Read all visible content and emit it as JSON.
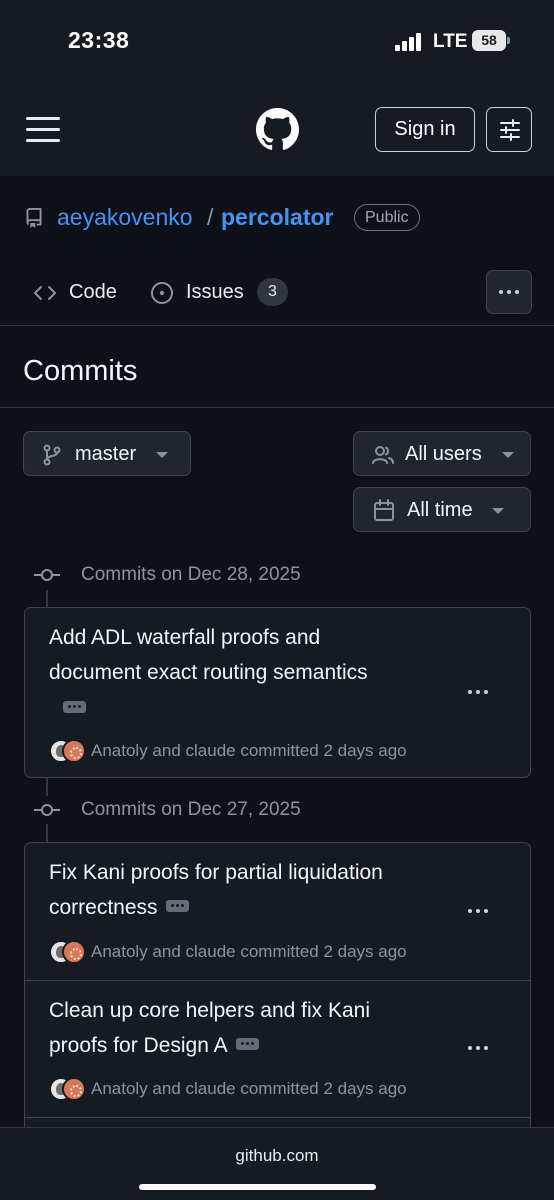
{
  "status_bar": {
    "time": "23:38",
    "network": "LTE",
    "battery": "58"
  },
  "header": {
    "sign_in_label": "Sign in"
  },
  "repo": {
    "owner": "aeyakovenko",
    "separator": "/",
    "name": "percolator",
    "visibility": "Public"
  },
  "tabs": [
    {
      "label": "Code",
      "icon": "code-icon"
    },
    {
      "label": "Issues",
      "icon": "issue-opened-icon",
      "count": "3"
    }
  ],
  "page": {
    "title": "Commits"
  },
  "filters": {
    "branch": "master",
    "users": "All users",
    "time": "All time"
  },
  "commit_groups": [
    {
      "heading": "Commits on Dec 28, 2025",
      "commits": [
        {
          "title_line1": "Add ADL waterfall proofs and",
          "title_line2": "document exact routing semantics",
          "meta": "Anatoly and claude committed 2 days ago"
        }
      ]
    },
    {
      "heading": "Commits on Dec 27, 2025",
      "commits": [
        {
          "title_line1": "Fix Kani proofs for partial liquidation",
          "title_line2": "correctness",
          "meta": "Anatoly and claude committed 2 days ago"
        },
        {
          "title_line1": "Clean up core helpers and fix Kani",
          "title_line2": "proofs for Design A",
          "meta": "Anatoly and claude committed 2 days ago"
        }
      ]
    }
  ],
  "footer": {
    "url": "github.com"
  },
  "colors": {
    "background": "#0d1117",
    "surface": "#161b22",
    "link": "#4493f8",
    "border": "#3d444d",
    "muted": "#8b949e"
  }
}
